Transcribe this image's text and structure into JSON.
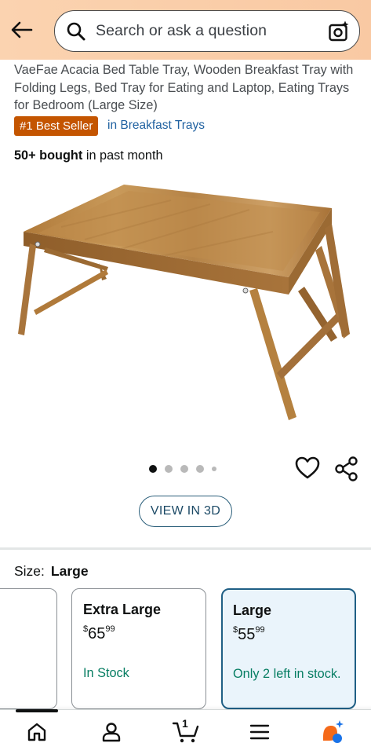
{
  "header": {
    "search_placeholder": "Search or ask a question",
    "back_icon": "arrow-left-icon",
    "search_icon": "magnifier-icon",
    "camera_icon": "camera-sparkle-icon",
    "bg_color": "#fbd3b0"
  },
  "product": {
    "title": "VaeFae Acacia Bed Table Tray, Wooden Breakfast Tray with Folding Legs, Bed Tray for Eating and Laptop, Eating Trays for Bedroom (Large Size)",
    "badge": "#1 Best Seller",
    "badge_category": "in Breakfast Trays",
    "bought_count": "50+ bought",
    "bought_suffix": " in past month",
    "view_3d": "VIEW IN 3D",
    "image_count": 5,
    "active_image": 1
  },
  "size": {
    "label": "Size:",
    "selected": "Large",
    "options": [
      {
        "name": "Extra Large",
        "currency": "$",
        "dollars": "65",
        "cents": "99",
        "stock": "In Stock"
      },
      {
        "name": "Large",
        "currency": "$",
        "dollars": "55",
        "cents": "99",
        "stock": "Only 2 left in stock."
      }
    ]
  },
  "nav": {
    "home_icon": "home-icon",
    "account_icon": "person-icon",
    "cart_icon": "cart-icon",
    "cart_count": "1",
    "menu_icon": "hamburger-icon",
    "assistant_icon": "rufus-assistant-icon"
  },
  "colors": {
    "badge": "#c45500",
    "link": "#2162a1",
    "stock_green": "#067d62",
    "selected_border": "#1f5f85"
  }
}
